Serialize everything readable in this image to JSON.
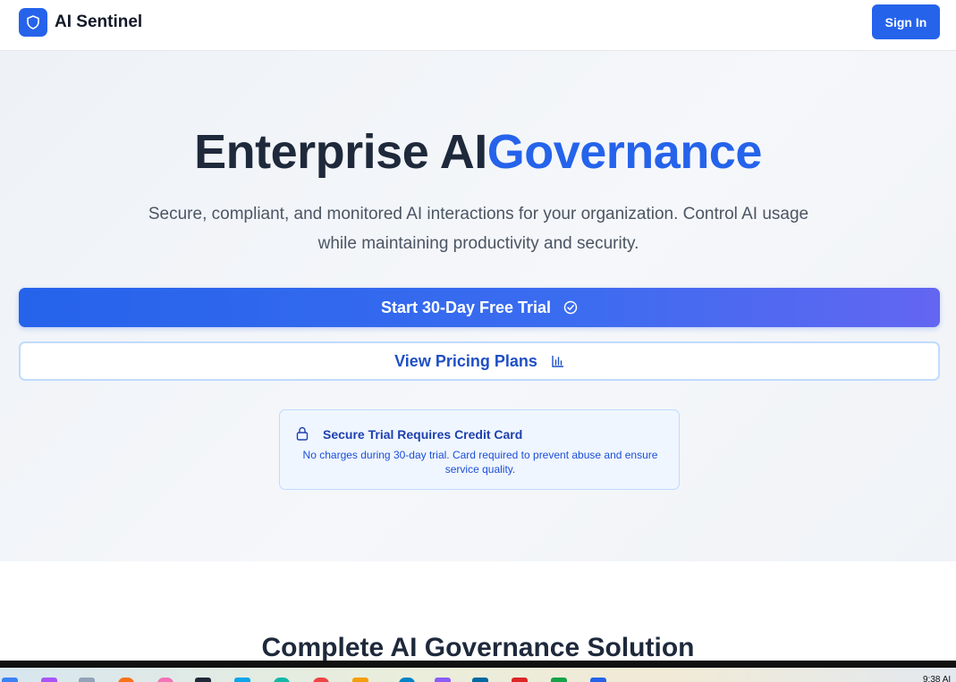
{
  "header": {
    "brand_name": "AI Sentinel",
    "brand_icon": "shield-icon",
    "signin_label": "Sign In"
  },
  "hero": {
    "title_main": "Enterprise AI",
    "title_accent": "Governance",
    "subtitle": "Secure, compliant, and monitored AI interactions for your organization. Control AI usage while maintaining productivity and security.",
    "trial_button": {
      "label": "Start 30-Day Free Trial",
      "icon": "check-circle-icon"
    },
    "pricing_button": {
      "label": "View Pricing Plans",
      "icon": "bar-chart-icon"
    },
    "notice": {
      "icon": "lock-icon",
      "title": "Secure Trial Requires Credit Card",
      "text": "No charges during 30-day trial. Card required to prevent abuse and ensure service quality."
    }
  },
  "features": {
    "title": "Complete AI Governance Solution"
  },
  "taskbar": {
    "clock": "9:38 AI"
  },
  "colors": {
    "accent": "#2563eb",
    "gradient_end": "#6366f1",
    "notice_bg": "#eff6ff",
    "notice_border": "#bfdbfe",
    "text_dark": "#1e293b"
  }
}
